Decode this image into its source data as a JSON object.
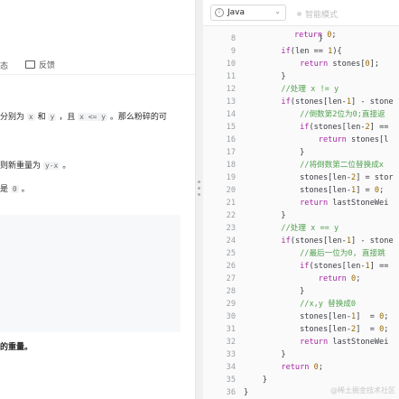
{
  "problem_pane": {
    "tabs": {
      "state_label": "态",
      "feedback_label": "反馈"
    },
    "p1": {
      "pre": "分别为",
      "x": "x",
      "and": "和",
      "y": "y",
      "mid": "，且",
      "cond": "x <= y",
      "post": "。那么粉碎的可"
    },
    "p2": {
      "text": "则新重量为",
      "yx": "y-x",
      "end": "。"
    },
    "p3": {
      "pre": "是",
      "zero": "0",
      "end": "。"
    },
    "bold_fragment": "的重量。"
  },
  "editor": {
    "language": "Java",
    "smart_mode_label": "智能模式",
    "lines": [
      {
        "n": "8",
        "segs": [
          {
            "t": "                "
          },
          {
            "t": "}"
          }
        ]
      },
      {
        "n": "9",
        "segs": [
          {
            "t": "        "
          },
          {
            "t": "if",
            "c": "kw"
          },
          {
            "t": "(len == "
          },
          {
            "t": "1",
            "c": "num"
          },
          {
            "t": "){"
          }
        ]
      },
      {
        "n": "10",
        "segs": [
          {
            "t": "            "
          },
          {
            "t": "return",
            "c": "kw"
          },
          {
            "t": " stones["
          },
          {
            "t": "0",
            "c": "num"
          },
          {
            "t": "];"
          }
        ]
      },
      {
        "n": "11",
        "segs": [
          {
            "t": "        }"
          }
        ]
      },
      {
        "n": "12",
        "segs": [
          {
            "t": "        "
          },
          {
            "t": "//处理 x != y",
            "c": "cm"
          }
        ]
      },
      {
        "n": "13",
        "segs": [
          {
            "t": "        "
          },
          {
            "t": "if",
            "c": "kw"
          },
          {
            "t": "(stones[len-"
          },
          {
            "t": "1",
            "c": "num"
          },
          {
            "t": "] - stone"
          }
        ]
      },
      {
        "n": "14",
        "segs": [
          {
            "t": "            "
          },
          {
            "t": "//倒数第2位为0;直接返",
            "c": "cm"
          }
        ]
      },
      {
        "n": "15",
        "segs": [
          {
            "t": "            "
          },
          {
            "t": "if",
            "c": "kw"
          },
          {
            "t": "(stones[len-"
          },
          {
            "t": "2",
            "c": "num"
          },
          {
            "t": "] =="
          }
        ]
      },
      {
        "n": "16",
        "segs": [
          {
            "t": "                "
          },
          {
            "t": "return",
            "c": "kw"
          },
          {
            "t": " stones[l"
          }
        ]
      },
      {
        "n": "17",
        "segs": [
          {
            "t": "            }"
          }
        ]
      },
      {
        "n": "18",
        "segs": [
          {
            "t": "            "
          },
          {
            "t": "//将倒数第二位替换成x",
            "c": "cm"
          }
        ]
      },
      {
        "n": "19",
        "segs": [
          {
            "t": "            stones[len-"
          },
          {
            "t": "2",
            "c": "num"
          },
          {
            "t": "] = stor"
          }
        ]
      },
      {
        "n": "20",
        "segs": [
          {
            "t": "            stones[len-"
          },
          {
            "t": "1",
            "c": "num"
          },
          {
            "t": "] = "
          },
          {
            "t": "0",
            "c": "num"
          },
          {
            "t": ";"
          }
        ]
      },
      {
        "n": "21",
        "segs": [
          {
            "t": "            "
          },
          {
            "t": "return",
            "c": "kw"
          },
          {
            "t": " lastStoneWei"
          }
        ]
      },
      {
        "n": "22",
        "segs": [
          {
            "t": "        }"
          }
        ]
      },
      {
        "n": "23",
        "segs": [
          {
            "t": "        "
          },
          {
            "t": "//处理 x == y",
            "c": "cm"
          }
        ]
      },
      {
        "n": "24",
        "segs": [
          {
            "t": "        "
          },
          {
            "t": "if",
            "c": "kw"
          },
          {
            "t": "(stones[len-"
          },
          {
            "t": "1",
            "c": "num"
          },
          {
            "t": "] - stone"
          }
        ]
      },
      {
        "n": "25",
        "segs": [
          {
            "t": "            "
          },
          {
            "t": "//最后一位为0, 直接跳",
            "c": "cm"
          }
        ]
      },
      {
        "n": "26",
        "segs": [
          {
            "t": "            "
          },
          {
            "t": "if",
            "c": "kw"
          },
          {
            "t": "(stones[len-"
          },
          {
            "t": "1",
            "c": "num"
          },
          {
            "t": "] =="
          }
        ]
      },
      {
        "n": "27",
        "segs": [
          {
            "t": "                "
          },
          {
            "t": "return",
            "c": "kw"
          },
          {
            "t": " "
          },
          {
            "t": "0",
            "c": "num"
          },
          {
            "t": ";"
          }
        ]
      },
      {
        "n": "28",
        "segs": [
          {
            "t": "            }"
          }
        ]
      },
      {
        "n": "29",
        "segs": [
          {
            "t": "            "
          },
          {
            "t": "//x,y 替换成0",
            "c": "cm"
          }
        ]
      },
      {
        "n": "30",
        "segs": [
          {
            "t": "            stones[len-"
          },
          {
            "t": "1",
            "c": "num"
          },
          {
            "t": "]  = "
          },
          {
            "t": "0",
            "c": "num"
          },
          {
            "t": ";"
          }
        ]
      },
      {
        "n": "31",
        "segs": [
          {
            "t": "            stones[len-"
          },
          {
            "t": "2",
            "c": "num"
          },
          {
            "t": "]  = "
          },
          {
            "t": "0",
            "c": "num"
          },
          {
            "t": ";"
          }
        ]
      },
      {
        "n": "32",
        "segs": [
          {
            "t": "            "
          },
          {
            "t": "return",
            "c": "kw"
          },
          {
            "t": " lastStoneWei"
          }
        ]
      },
      {
        "n": "33",
        "segs": [
          {
            "t": "        }"
          }
        ]
      },
      {
        "n": "34",
        "segs": [
          {
            "t": "        "
          },
          {
            "t": "return",
            "c": "kw"
          },
          {
            "t": " "
          },
          {
            "t": "0",
            "c": "num"
          },
          {
            "t": ";"
          }
        ]
      },
      {
        "n": "35",
        "segs": [
          {
            "t": "    }"
          }
        ]
      },
      {
        "n": "36",
        "segs": [
          {
            "t": "}"
          }
        ]
      }
    ],
    "top_partial": {
      "kw": "return",
      "num": "0"
    }
  },
  "watermark": "@稀土掘金技术社区"
}
